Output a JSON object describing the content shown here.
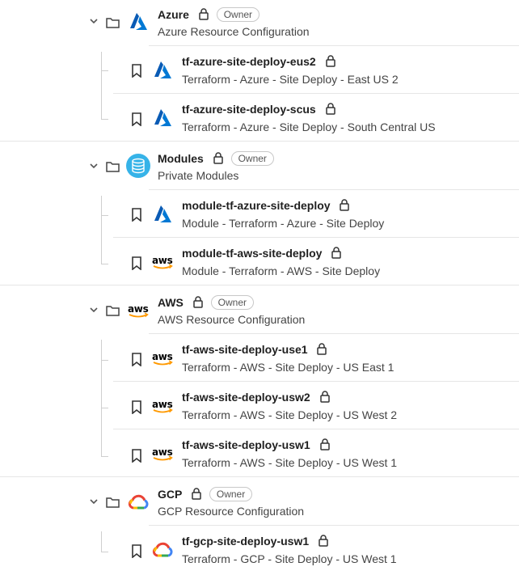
{
  "groups": [
    {
      "name": "Azure",
      "description": "Azure Resource Configuration",
      "badge": "Owner",
      "logo": "azure-icon",
      "items": [
        {
          "name": "tf-azure-site-deploy-eus2",
          "description": "Terraform - Azure - Site Deploy - East US 2",
          "logo": "azure-icon"
        },
        {
          "name": "tf-azure-site-deploy-scus",
          "description": "Terraform - Azure - Site Deploy - South Central US",
          "logo": "azure-icon"
        }
      ]
    },
    {
      "name": "Modules",
      "description": "Private Modules",
      "badge": "Owner",
      "logo": "database-icon",
      "items": [
        {
          "name": "module-tf-azure-site-deploy",
          "description": "Module - Terraform - Azure - Site Deploy",
          "logo": "azure-icon"
        },
        {
          "name": "module-tf-aws-site-deploy",
          "description": "Module - Terraform - AWS - Site Deploy",
          "logo": "aws-icon"
        }
      ]
    },
    {
      "name": "AWS",
      "description": "AWS Resource Configuration",
      "badge": "Owner",
      "logo": "aws-icon",
      "items": [
        {
          "name": "tf-aws-site-deploy-use1",
          "description": "Terraform - AWS - Site Deploy - US East 1",
          "logo": "aws-icon"
        },
        {
          "name": "tf-aws-site-deploy-usw2",
          "description": "Terraform - AWS - Site Deploy - US West 2",
          "logo": "aws-icon"
        },
        {
          "name": "tf-aws-site-deploy-usw1",
          "description": "Terraform - AWS - Site Deploy - US West 1",
          "logo": "aws-icon"
        }
      ]
    },
    {
      "name": "GCP",
      "description": "GCP Resource Configuration",
      "badge": "Owner",
      "logo": "gcp-icon",
      "items": [
        {
          "name": "tf-gcp-site-deploy-usw1",
          "description": "Terraform - GCP - Site Deploy - US West 1",
          "logo": "gcp-icon"
        }
      ]
    }
  ],
  "aws_logo_text": "aws",
  "colors": {
    "azure": "#0078d4",
    "modules": "#36b3e8",
    "aws_orange": "#ff9900",
    "aws_dark": "#232f3e"
  }
}
